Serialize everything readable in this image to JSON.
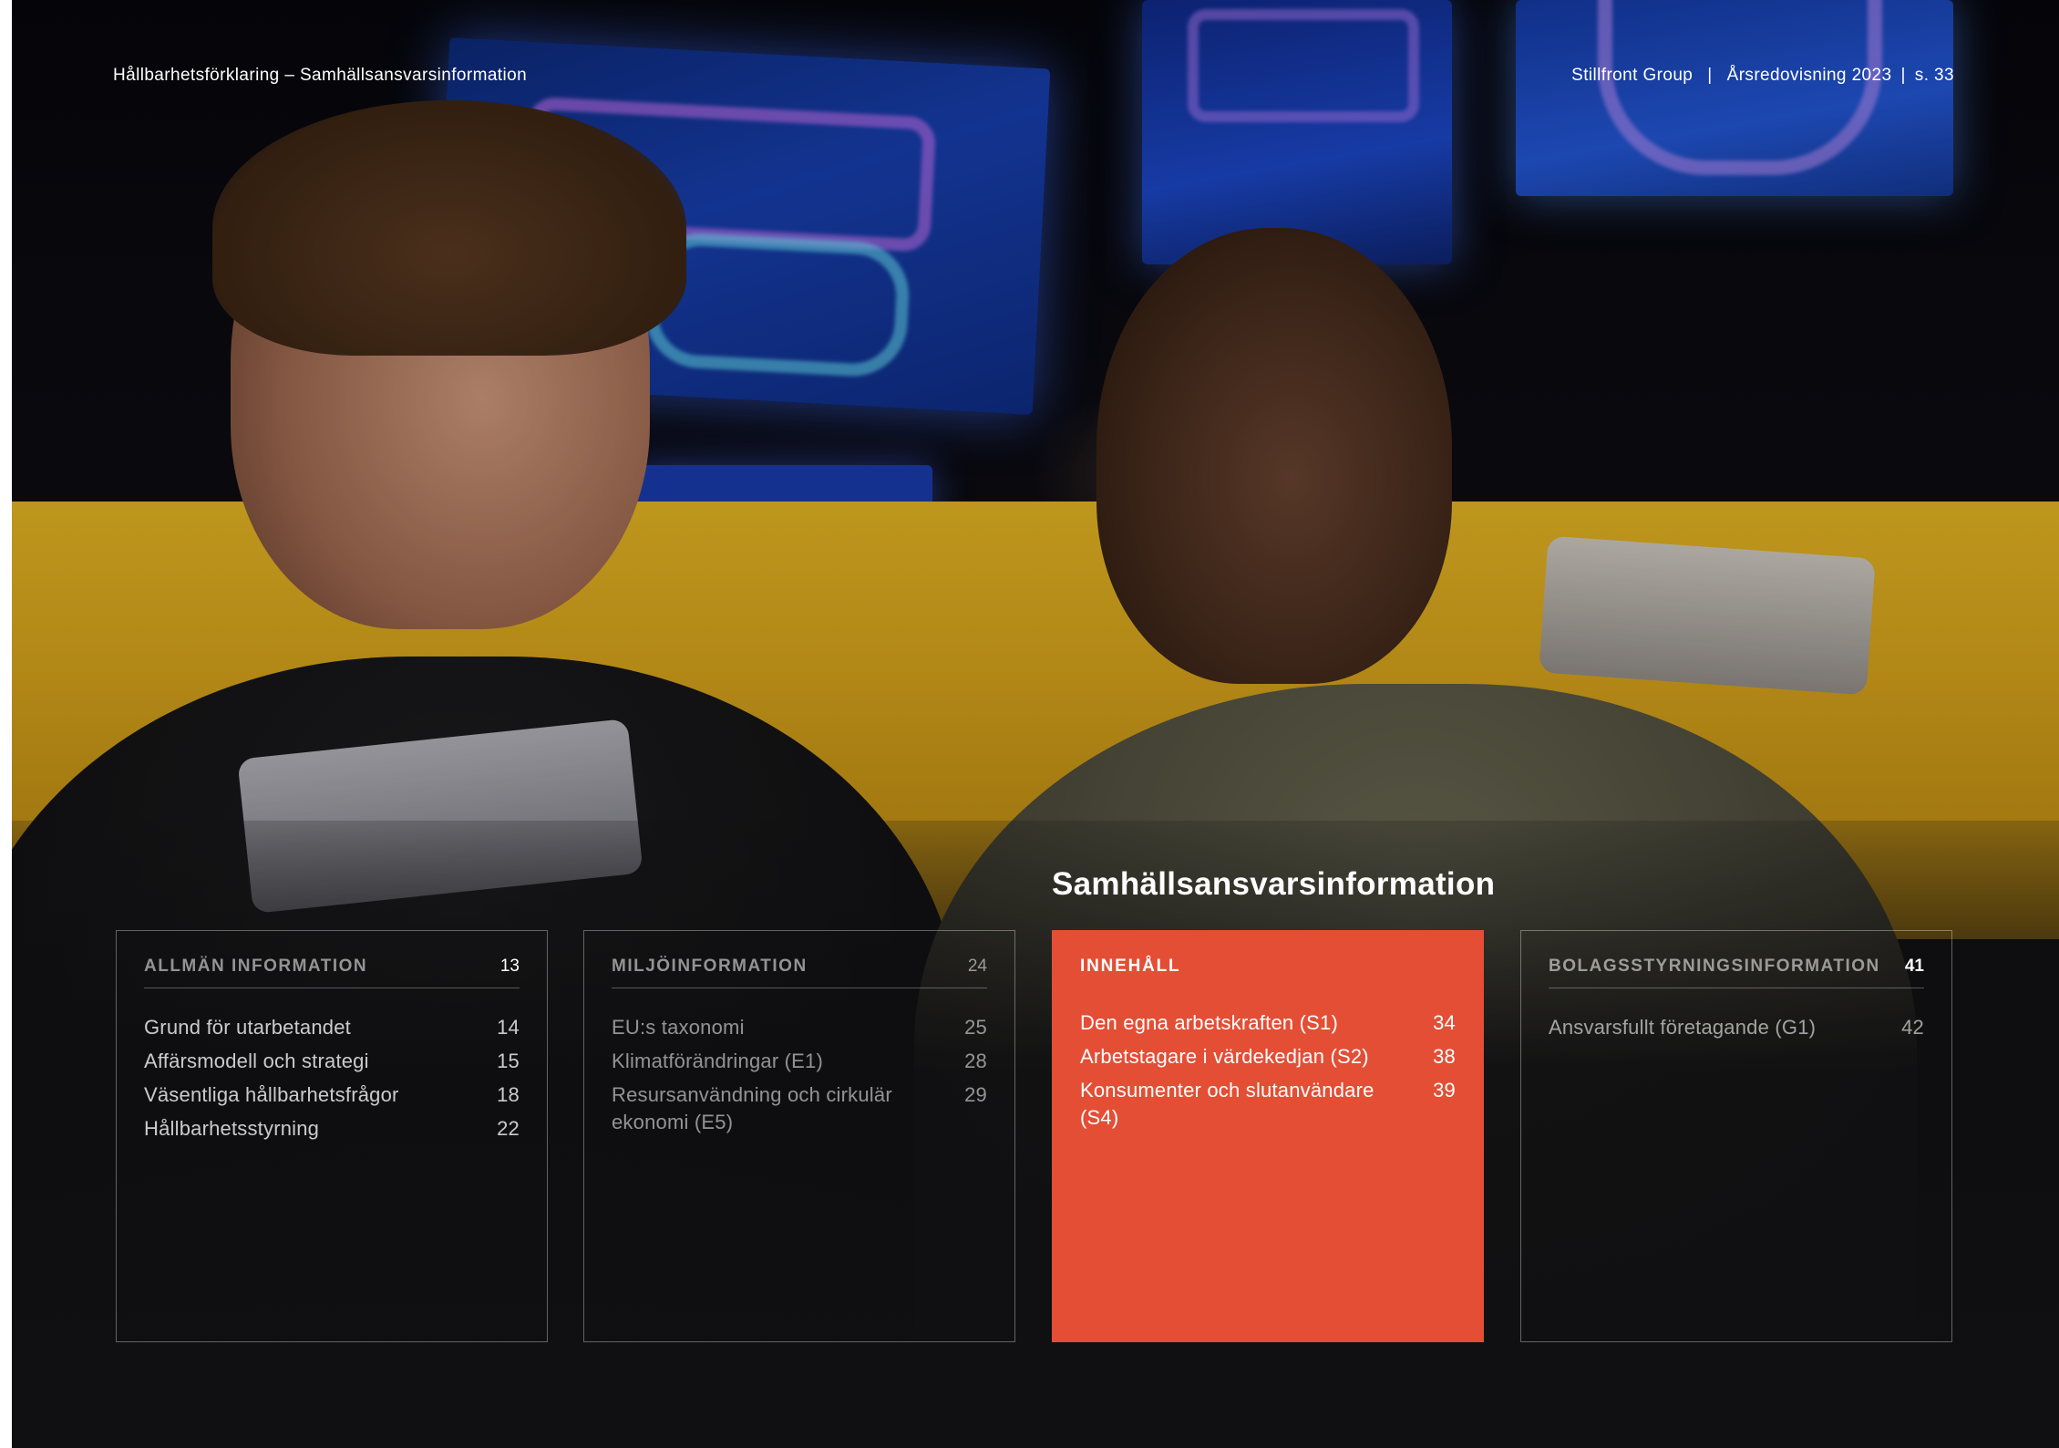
{
  "header": {
    "left": "Hållbarhetsförklaring – Samhällsansvarsinformation",
    "company": "Stillfront Group",
    "report": "Årsredovisning 2023",
    "page": "s. 33"
  },
  "section_title": "Samhällsansvarsinformation",
  "boxes": [
    {
      "title": "ALLMÄN INFORMATION",
      "page": "13",
      "items": [
        {
          "label": "Grund för utarbetandet",
          "page": "14"
        },
        {
          "label": "Affärsmodell och strategi",
          "page": "15"
        },
        {
          "label": "Väsentliga hållbarhetsfrågor",
          "page": "18"
        },
        {
          "label": "Hållbarhetsstyrning",
          "page": "22"
        }
      ]
    },
    {
      "title": "MILJÖINFORMATION",
      "page": "24",
      "items": [
        {
          "label": "EU:s taxonomi",
          "page": "25"
        },
        {
          "label": "Klimatförändringar (E1)",
          "page": "28"
        },
        {
          "label": "Resursanvändning och cirkulär ekonomi (E5)",
          "page": "29"
        }
      ]
    },
    {
      "title": "INNEHÅLL",
      "page": "",
      "items": [
        {
          "label": "Den egna arbetskraften (S1)",
          "page": "34"
        },
        {
          "label": "Arbetstagare i värdekedjan (S2)",
          "page": "38"
        },
        {
          "label": "Konsumenter och slutanvändare (S4)",
          "page": "39"
        }
      ]
    },
    {
      "title": "BOLAGSSTYRNINGSINFORMATION",
      "page": "41",
      "items": [
        {
          "label": "Ansvarsfullt företagande (G1)",
          "page": "42"
        }
      ]
    }
  ],
  "colors": {
    "accent": "#e34e35",
    "text": "#ffffff"
  }
}
